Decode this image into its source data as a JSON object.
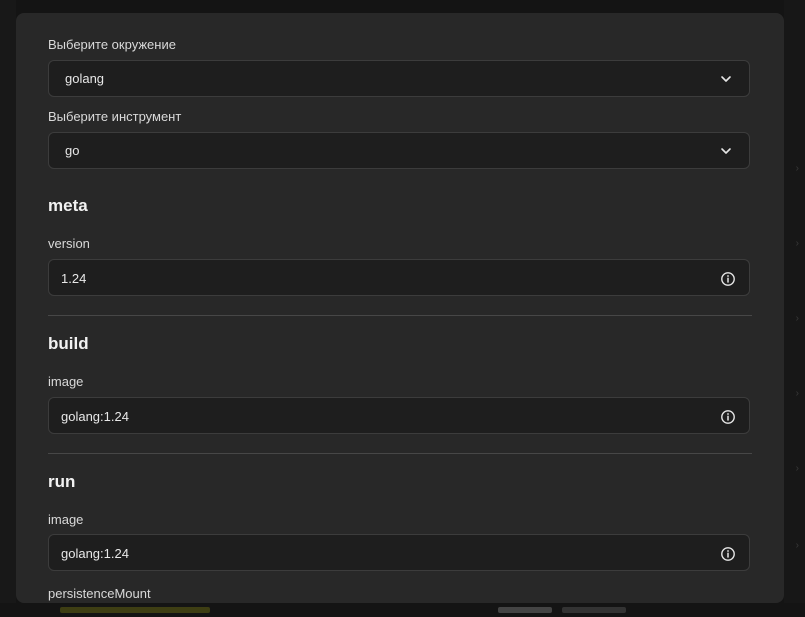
{
  "environment": {
    "label": "Выберите окружение",
    "value": "golang"
  },
  "tool": {
    "label": "Выберите инструмент",
    "value": "go"
  },
  "sections": {
    "meta": {
      "title": "meta",
      "version_label": "version",
      "version_value": "1.24"
    },
    "build": {
      "title": "build",
      "image_label": "image",
      "image_value": "golang:1.24"
    },
    "run": {
      "title": "run",
      "image_label": "image",
      "image_value": "golang:1.24",
      "persistence_label": "persistenceMount"
    }
  },
  "icons": {
    "select_chevron": "chevron-down-icon",
    "field_info": "info-icon"
  },
  "colors": {
    "modal_bg": "#282828",
    "field_bg": "#1e1e1e",
    "field_border": "#3c3c3c",
    "text": "#e6e6e6"
  }
}
